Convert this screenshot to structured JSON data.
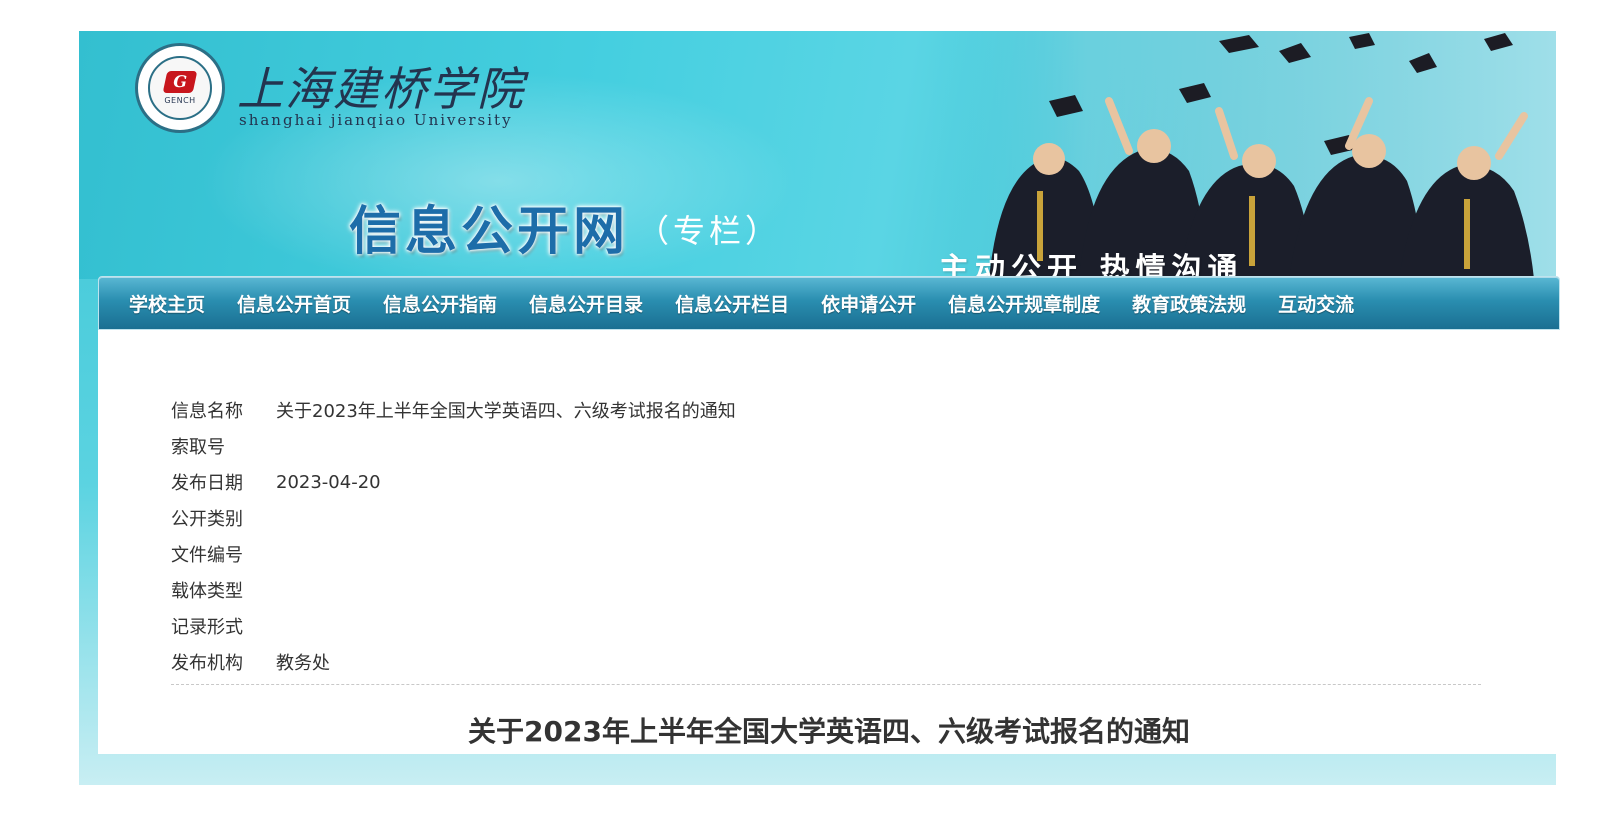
{
  "header": {
    "school_name_cn": "上海建桥学院",
    "school_name_en": "shanghai jianqiao University",
    "seal_mark": "G",
    "seal_text": "GENCH",
    "site_title": "信息公开网",
    "site_subtitle": "（专栏）",
    "slogan": "主动公开 热情沟通",
    "colors": {
      "title": "#1d6da9",
      "banner": "#45cfe0"
    }
  },
  "nav": {
    "items": [
      {
        "label": "学校主页"
      },
      {
        "label": "信息公开首页"
      },
      {
        "label": "信息公开指南"
      },
      {
        "label": "信息公开目录"
      },
      {
        "label": "信息公开栏目"
      },
      {
        "label": "依申请公开"
      },
      {
        "label": "信息公开规章制度"
      },
      {
        "label": "教育政策法规"
      },
      {
        "label": "互动交流"
      }
    ]
  },
  "meta": {
    "rows": [
      {
        "label": "信息名称",
        "value": "关于2023年上半年全国大学英语四、六级考试报名的通知"
      },
      {
        "label": "索取号",
        "value": ""
      },
      {
        "label": "发布日期",
        "value": "2023-04-20"
      },
      {
        "label": "公开类别",
        "value": ""
      },
      {
        "label": "文件编号",
        "value": ""
      },
      {
        "label": "载体类型",
        "value": ""
      },
      {
        "label": "记录形式",
        "value": ""
      },
      {
        "label": "发布机构",
        "value": "教务处"
      }
    ]
  },
  "article": {
    "title": "关于2023年上半年全国大学英语四、六级考试报名的通知"
  }
}
